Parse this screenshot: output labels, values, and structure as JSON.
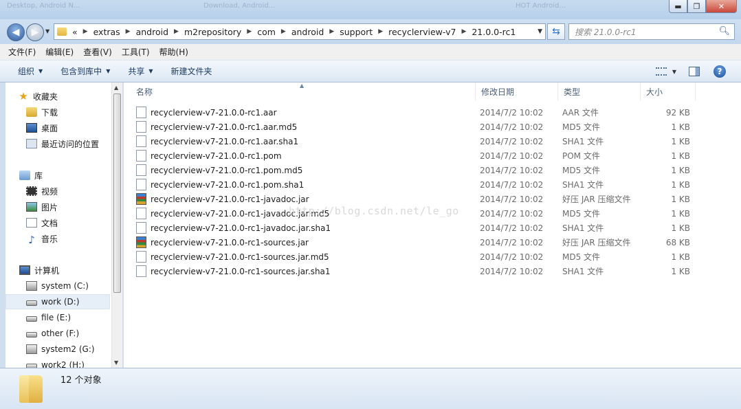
{
  "titlebar": {
    "ghost_texts": [
      "Desktop, Android N...",
      "Download, Android...",
      "HOT Android..."
    ],
    "min_glyph": "▬",
    "max_glyph": "❐",
    "close_glyph": "✕"
  },
  "address": {
    "overflow": "«",
    "crumbs": [
      "extras",
      "android",
      "m2repository",
      "com",
      "android",
      "support",
      "recyclerview-v7",
      "21.0.0-rc1"
    ],
    "search_placeholder": "搜索 21.0.0-rc1"
  },
  "menu": [
    "文件(F)",
    "编辑(E)",
    "查看(V)",
    "工具(T)",
    "帮助(H)"
  ],
  "commands": {
    "organize": "组织",
    "include_library": "包含到库中",
    "share": "共享",
    "new_folder": "新建文件夹"
  },
  "nav": {
    "favorites": "收藏夹",
    "downloads": "下载",
    "desktop": "桌面",
    "recent": "最近访问的位置",
    "libraries": "库",
    "videos": "视频",
    "pictures": "图片",
    "documents": "文档",
    "music": "音乐",
    "computer": "计算机",
    "drives": [
      "system (C:)",
      "work (D:)",
      "file (E:)",
      "other (F:)",
      "system2 (G:)",
      "work2 (H:)"
    ]
  },
  "columns": {
    "name": "名称",
    "date": "修改日期",
    "type": "类型",
    "size": "大小"
  },
  "files": [
    {
      "name": "recyclerview-v7-21.0.0-rc1.aar",
      "date": "2014/7/2 10:02",
      "type": "AAR 文件",
      "size": "92 KB",
      "icon": "plain"
    },
    {
      "name": "recyclerview-v7-21.0.0-rc1.aar.md5",
      "date": "2014/7/2 10:02",
      "type": "MD5 文件",
      "size": "1 KB",
      "icon": "plain"
    },
    {
      "name": "recyclerview-v7-21.0.0-rc1.aar.sha1",
      "date": "2014/7/2 10:02",
      "type": "SHA1 文件",
      "size": "1 KB",
      "icon": "plain"
    },
    {
      "name": "recyclerview-v7-21.0.0-rc1.pom",
      "date": "2014/7/2 10:02",
      "type": "POM 文件",
      "size": "1 KB",
      "icon": "plain"
    },
    {
      "name": "recyclerview-v7-21.0.0-rc1.pom.md5",
      "date": "2014/7/2 10:02",
      "type": "MD5 文件",
      "size": "1 KB",
      "icon": "plain"
    },
    {
      "name": "recyclerview-v7-21.0.0-rc1.pom.sha1",
      "date": "2014/7/2 10:02",
      "type": "SHA1 文件",
      "size": "1 KB",
      "icon": "plain"
    },
    {
      "name": "recyclerview-v7-21.0.0-rc1-javadoc.jar",
      "date": "2014/7/2 10:02",
      "type": "好压 JAR 压缩文件",
      "size": "1 KB",
      "icon": "jar"
    },
    {
      "name": "recyclerview-v7-21.0.0-rc1-javadoc.jar.md5",
      "date": "2014/7/2 10:02",
      "type": "MD5 文件",
      "size": "1 KB",
      "icon": "plain"
    },
    {
      "name": "recyclerview-v7-21.0.0-rc1-javadoc.jar.sha1",
      "date": "2014/7/2 10:02",
      "type": "SHA1 文件",
      "size": "1 KB",
      "icon": "plain"
    },
    {
      "name": "recyclerview-v7-21.0.0-rc1-sources.jar",
      "date": "2014/7/2 10:02",
      "type": "好压 JAR 压缩文件",
      "size": "68 KB",
      "icon": "jar"
    },
    {
      "name": "recyclerview-v7-21.0.0-rc1-sources.jar.md5",
      "date": "2014/7/2 10:02",
      "type": "MD5 文件",
      "size": "1 KB",
      "icon": "plain"
    },
    {
      "name": "recyclerview-v7-21.0.0-rc1-sources.jar.sha1",
      "date": "2014/7/2 10:02",
      "type": "SHA1 文件",
      "size": "1 KB",
      "icon": "plain"
    }
  ],
  "watermark": "http://blog.csdn.net/le_go",
  "status": {
    "count_text": "12 个对象"
  }
}
